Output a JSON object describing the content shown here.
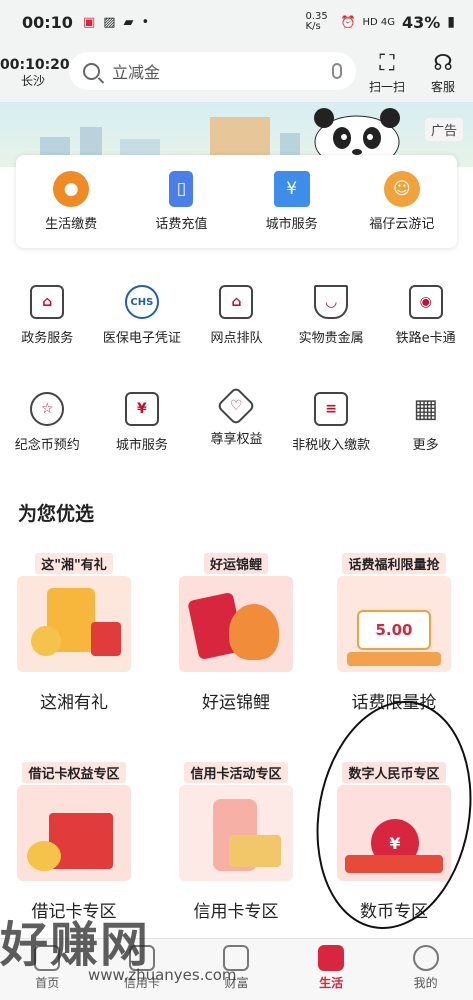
{
  "status_bar": {
    "time": "00:10",
    "speed": "0.35 K/s",
    "network": "HD 4G",
    "battery": "43%"
  },
  "header": {
    "clock_time": "00:10:20",
    "city": "长沙",
    "search_placeholder": "立减金",
    "scan_label": "扫一扫",
    "service_label": "客服"
  },
  "banner": {
    "ad_tag": "广告"
  },
  "quick_services": [
    {
      "label": "生活缴费",
      "icon": "water-drop-icon",
      "color": "#f08a24",
      "glyph": "💧"
    },
    {
      "label": "话费充值",
      "icon": "phone-icon",
      "color": "#4a7ee8",
      "glyph": "▯"
    },
    {
      "label": "城市服务",
      "icon": "city-building-icon",
      "color": "#3d8ee8",
      "glyph": "¥"
    },
    {
      "label": "福仔云游记",
      "icon": "mascot-icon",
      "color": "#f2a23a",
      "glyph": "☺"
    }
  ],
  "services_row1": [
    {
      "label": "政务服务",
      "icon": "government-icon",
      "glyph": "⌂"
    },
    {
      "label": "医保电子凭证",
      "icon": "chs-medical-icon",
      "glyph": "CHS"
    },
    {
      "label": "网点排队",
      "icon": "branch-queue-icon",
      "glyph": "⌂"
    },
    {
      "label": "实物贵金属",
      "icon": "gold-ingot-icon",
      "glyph": "◡"
    },
    {
      "label": "铁路e卡通",
      "icon": "railway-card-icon",
      "glyph": "◉"
    }
  ],
  "services_row2": [
    {
      "label": "纪念币预约",
      "icon": "coin-star-icon",
      "glyph": "☆"
    },
    {
      "label": "城市服务",
      "icon": "city-service-icon",
      "glyph": "¥"
    },
    {
      "label": "尊享权益",
      "icon": "privilege-icon",
      "glyph": "♡"
    },
    {
      "label": "非税收入缴款",
      "icon": "tax-ticket-icon",
      "glyph": "≡"
    },
    {
      "label": "更多",
      "icon": "more-grid-icon",
      "glyph": "▦"
    }
  ],
  "section_title": "为您优选",
  "promos_row1": [
    {
      "tag": "这\"湘\"有礼",
      "name": "这湘有礼",
      "tag_bg": "#fde7e2",
      "img_bg": "#fde7dc"
    },
    {
      "tag": "好运锦鲤",
      "name": "好运锦鲤",
      "tag_bg": "#fde2e2",
      "img_bg": "#fde0db"
    },
    {
      "tag": "话费福利限量抢",
      "name": "话费限量抢",
      "tag_bg": "#fde5e0",
      "img_bg": "#fde7df",
      "amount": "5.00"
    }
  ],
  "promos_row2": [
    {
      "tag": "借记卡权益专区",
      "name": "借记卡专区",
      "tag_bg": "#fde5e0",
      "img_bg": "#fde2dc"
    },
    {
      "tag": "信用卡活动专区",
      "name": "信用卡专区",
      "tag_bg": "#fde5e0",
      "img_bg": "#fdeae6"
    },
    {
      "tag": "数字人民币专区",
      "name": "数币专区",
      "tag_bg": "#fde2df",
      "img_bg": "#fde0dd"
    }
  ],
  "tabs": [
    {
      "label": "首页",
      "icon": "home-icon",
      "active": false
    },
    {
      "label": "信用卡",
      "icon": "credit-card-icon",
      "active": false
    },
    {
      "label": "财富",
      "icon": "wealth-chart-icon",
      "active": false
    },
    {
      "label": "生活",
      "icon": "life-bag-icon",
      "active": true
    },
    {
      "label": "我的",
      "icon": "profile-icon",
      "active": false
    }
  ],
  "watermark": {
    "text": "好赚网",
    "url": "www.zhuanyes.com"
  },
  "colors": {
    "accent": "#d7263d",
    "header_bg": "#f1f4f3"
  }
}
